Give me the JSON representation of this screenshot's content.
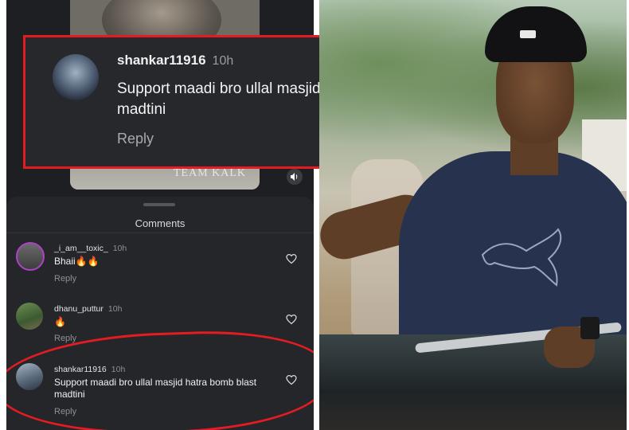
{
  "video": {
    "watermark": "TEAM KALK"
  },
  "comments_sheet": {
    "title": "Comments",
    "items": [
      {
        "username": "_i_am__toxic_",
        "time": "10h",
        "text": "Bhaii🔥🔥",
        "reply": "Reply"
      },
      {
        "username": "dhanu_puttur",
        "time": "10h",
        "text": "🔥",
        "reply": "Reply"
      },
      {
        "username": "shankar11916",
        "time": "10h",
        "text": "Support maadi bro ullal masjid hatra bomb blast madtini",
        "reply": "Reply"
      }
    ]
  },
  "highlighted_comment": {
    "username": "shankar11916",
    "time": "10h",
    "text": "Support maadi bro ullal masjid hatra bomb blast madtini",
    "reply": "Reply"
  },
  "colors": {
    "highlight": "#e21c22",
    "panel": "#25262a",
    "text": "#f2f2f4",
    "muted": "#8e8f94"
  },
  "icons": [
    "speaker-icon",
    "heart-icon"
  ]
}
